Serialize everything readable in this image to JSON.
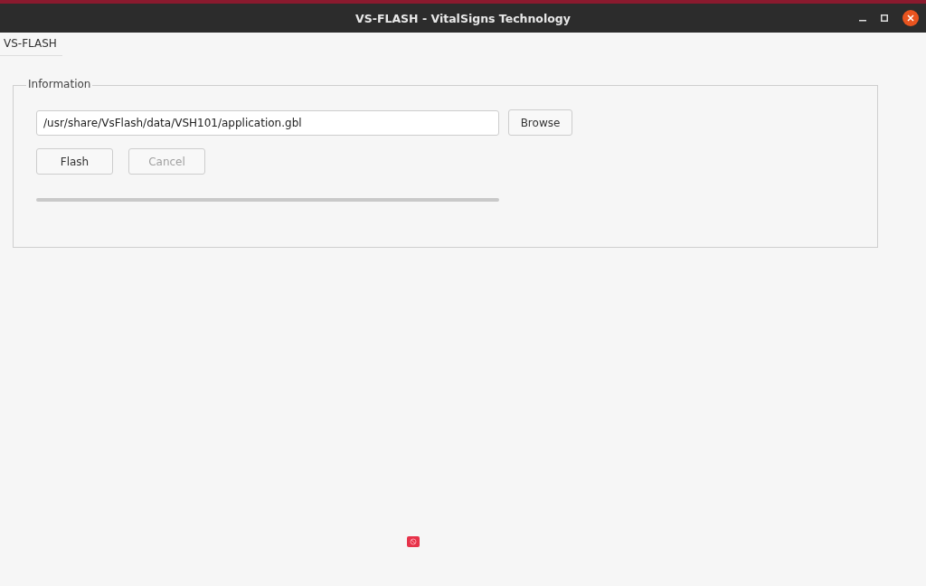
{
  "window": {
    "title": "VS-FLASH - VitalSigns Technology"
  },
  "tabs": [
    {
      "label": "VS-FLASH",
      "selected": true
    }
  ],
  "group": {
    "title": "Information",
    "file_field": {
      "value": "/usr/share/VsFlash/data/VSH101/application.gbl"
    },
    "browse_button": {
      "label": "Browse",
      "disabled": false
    },
    "buttons": [
      {
        "label": "Flash",
        "disabled": false
      },
      {
        "label": "Cancel",
        "disabled": true
      }
    ],
    "progress": {
      "level": 0
    }
  }
}
